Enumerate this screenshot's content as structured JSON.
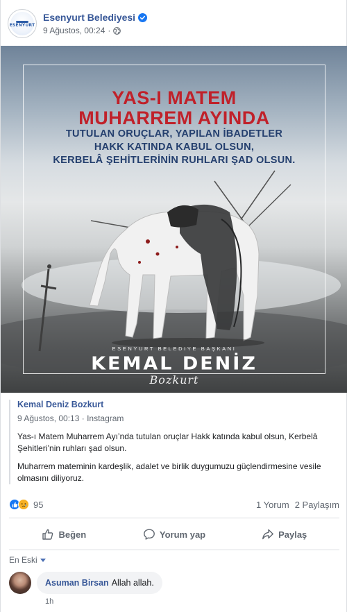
{
  "post": {
    "page_name": "Esenyurt Belediyesi",
    "timestamp": "9 Ağustos, 00:24",
    "separator": "·",
    "avatar_text": "ESENYURT"
  },
  "image": {
    "title_line1": "YAS-I MATEM",
    "title_line2": "MUHARREM AYINDA",
    "sub_line1": "TUTULAN ORUÇLAR, YAPILAN İBADETLER",
    "sub_line2": "HAKK KATINDA KABUL OLSUN,",
    "sub_line3": "KERBELÂ ŞEHİTLERİNİN RUHLARI ŞAD OLSUN.",
    "signature_label": "ESENYURT BELEDIYE BAŞKANI",
    "signature_name": "KEMAL DENİZ",
    "signature_script": "Bozkurt"
  },
  "shared": {
    "author": "Kemal Deniz Bozkurt",
    "meta": "9 Ağustos, 00:13 · Instagram",
    "paragraph1": "Yas-ı Matem Muharrem Ayı’nda tutulan oruçlar Hakk katında kabul olsun, Kerbelâ Şehitleri’nin ruhları şad olsun.",
    "paragraph2": "Muharrem mateminin kardeşlik, adalet ve birlik duygumuzu güçlendirmesine vesile olmasını diliyoruz."
  },
  "stats": {
    "reaction_count": "95",
    "comments": "1 Yorum",
    "shares": "2 Paylaşım"
  },
  "actions": {
    "like": "Beğen",
    "comment": "Yorum yap",
    "share": "Paylaş"
  },
  "comments": {
    "sort_label": "En Eski",
    "items": [
      {
        "author": "Asuman Birsan",
        "text": "Allah allah.",
        "time": "1h"
      }
    ]
  },
  "colors": {
    "link": "#385898",
    "like_blue": "#1877f2",
    "title_red": "#c0212a",
    "subtitle_navy": "#243f6e"
  }
}
